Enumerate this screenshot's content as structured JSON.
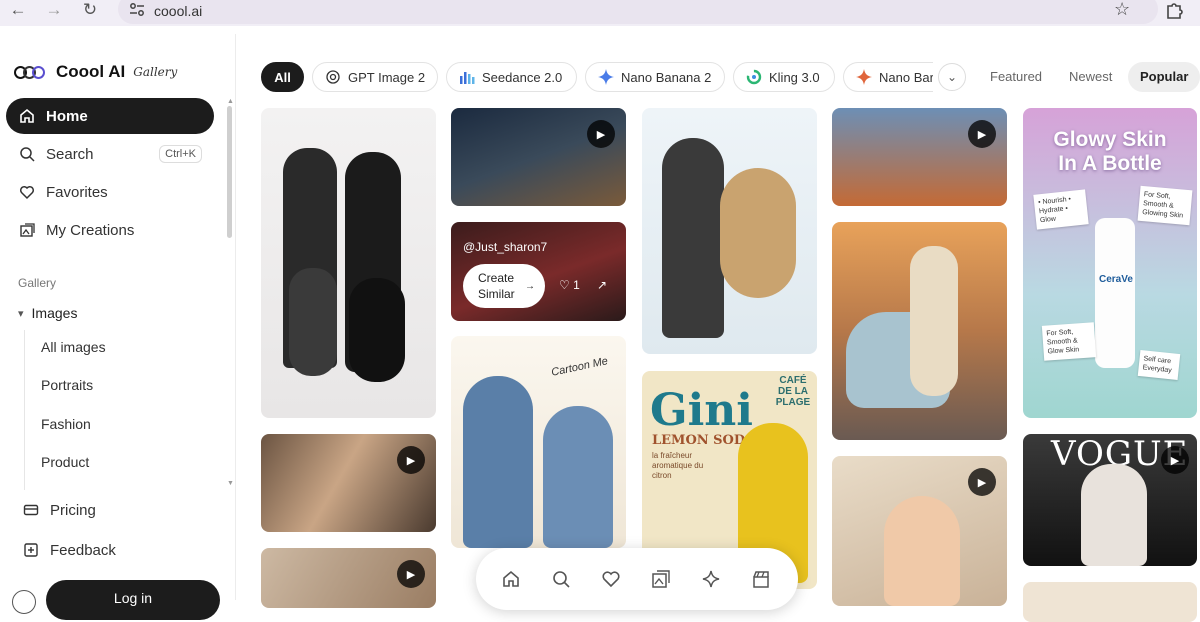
{
  "browser": {
    "url": "coool.ai",
    "back_glyph": "←",
    "forward_glyph": "→",
    "reload_glyph": "↻",
    "star_glyph": "☆"
  },
  "brand": {
    "name": "Coool AI",
    "subtitle": "Gallery"
  },
  "sidebar": {
    "home": "Home",
    "search": "Search",
    "search_shortcut": "Ctrl+K",
    "favorites": "Favorites",
    "my_creations": "My Creations",
    "gallery_label": "Gallery",
    "images": "Images",
    "sub_items": [
      "All images",
      "Portraits",
      "Fashion",
      "Product"
    ],
    "pricing": "Pricing",
    "feedback": "Feedback",
    "login": "Log in"
  },
  "filters": {
    "chips": [
      "All",
      "GPT Image 2",
      "Seedance 2.0",
      "Nano Banana 2",
      "Kling 3.0",
      "Nano Bar"
    ],
    "active_chip": "All",
    "sort_tabs": [
      "Featured",
      "Newest",
      "Popular"
    ],
    "active_sort": "Popular"
  },
  "gallery": {
    "hover_card": {
      "username": "@Just_sharon7",
      "create_similar_line1": "Create",
      "create_similar_line2": "Similar",
      "like_count": "1"
    },
    "gini": {
      "title": "Gini",
      "subtitle": "LEMON SODA",
      "tagline": "la fraîcheur aromatique du citron",
      "cafe": "CAFÉ DE LA PLAGE"
    },
    "glowy": {
      "title_line1": "Glowy Skin",
      "title_line2": "In A Bottle",
      "note_a": "• Nourish • Hydrate • Glow",
      "note_b": "For Soft, Smooth & Glowing Skin",
      "note_c": "For Soft, Smooth & Glow Skin",
      "note_d": "Self care Everyday",
      "brand": "CeraVe"
    },
    "vogue": "VOGUE",
    "cartoon_note": "Cartoon Me"
  },
  "colors": {
    "accent_dark": "#1c1c1c",
    "chip_border": "#e3e3e3",
    "sidebar_border": "#ececec"
  }
}
